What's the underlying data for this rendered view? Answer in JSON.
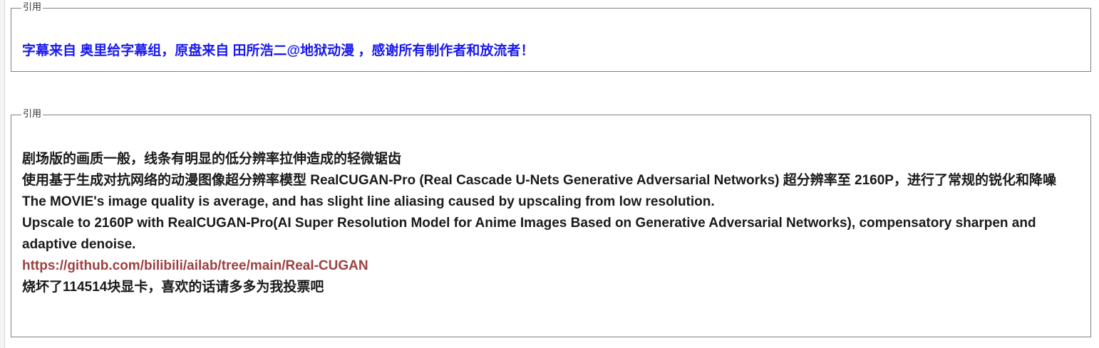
{
  "quotes": [
    {
      "legend": "引用",
      "lines": [
        "字幕来自 奥里给字幕组，原盘来自 田所浩二@地狱动漫 ，感谢所有制作者和放流者！"
      ]
    },
    {
      "legend": "引用",
      "lines": [
        "剧场版的画质一般，线条有明显的低分辨率拉伸造成的轻微锯齿",
        "使用基于生成对抗网络的动漫图像超分辨率模型 RealCUGAN-Pro (Real Cascade U-Nets Generative Adversarial Networks) 超分辨率至 2160P，进行了常规的锐化和降噪",
        "The MOVIE's image quality is average, and has slight line aliasing caused by upscaling from low resolution.",
        "Upscale to 2160P with RealCUGAN-Pro(AI Super Resolution Model for Anime Images Based on Generative Adversarial Networks), compensatory sharpen and adaptive denoise.",
        "https://github.com/bilibili/ailab/tree/main/Real-CUGAN",
        "烧坏了114514块显卡，喜欢的话请多多为我投票吧"
      ]
    }
  ],
  "colors": {
    "quote1_text": "#1a1aee",
    "quote2_text": "#1a1a1a",
    "link": "#9c4141",
    "border": "#808080"
  }
}
